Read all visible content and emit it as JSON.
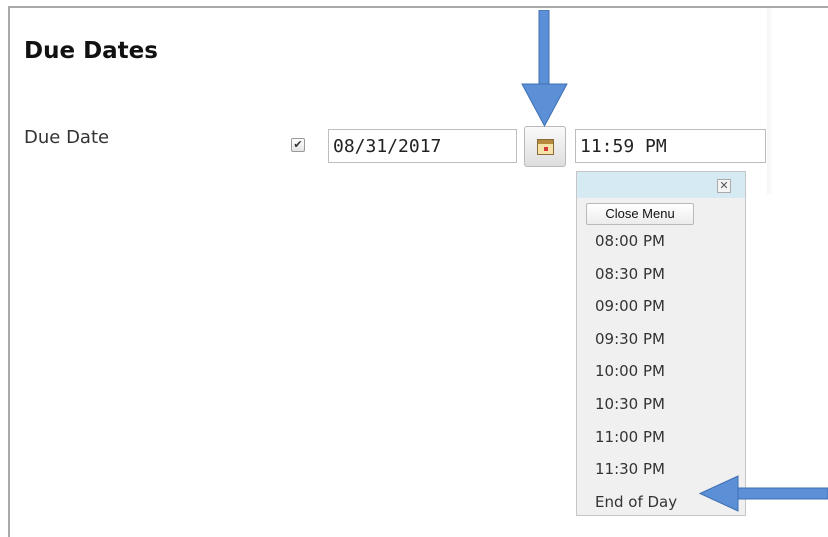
{
  "section": {
    "title": "Due Dates"
  },
  "due_date": {
    "label": "Due Date",
    "enabled_checkmark": "✔",
    "date_value": "08/31/2017",
    "time_value": "11:59 PM"
  },
  "time_menu": {
    "close_glyph": "✕",
    "close_label": "Close Menu",
    "options": [
      "08:00 PM",
      "08:30 PM",
      "09:00 PM",
      "09:30 PM",
      "10:00 PM",
      "10:30 PM",
      "11:00 PM",
      "11:30 PM",
      "End of Day"
    ]
  },
  "annotations": {
    "arrow_color": "#5b8fd6"
  }
}
